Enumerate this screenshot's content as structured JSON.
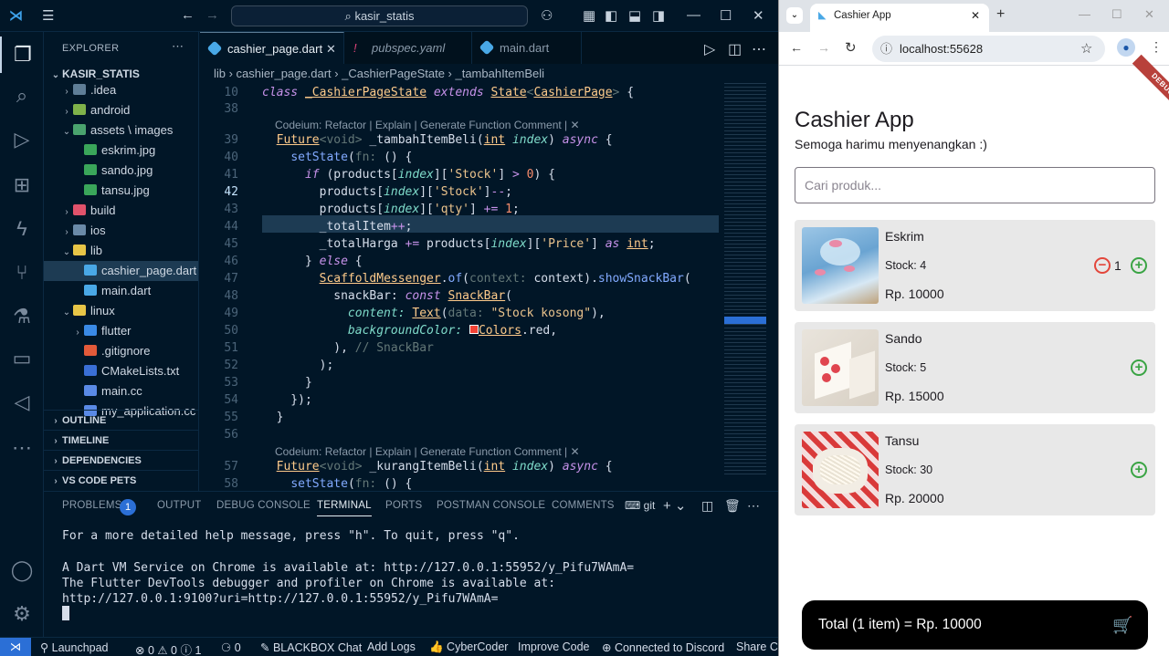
{
  "vscode": {
    "search_text": "kasir_statis",
    "sidebar": {
      "title": "EXPLORER",
      "tree": [
        {
          "label": ".idea",
          "chev": "›"
        },
        {
          "label": "android",
          "chev": "›"
        },
        {
          "label": "assets \\ images",
          "chev": "⌄"
        },
        {
          "label": "eskrim.jpg",
          "chev": ""
        },
        {
          "label": "sando.jpg",
          "chev": ""
        },
        {
          "label": "tansu.jpg",
          "chev": ""
        },
        {
          "label": "build",
          "chev": "›"
        },
        {
          "label": "ios",
          "chev": "›"
        },
        {
          "label": "lib",
          "chev": "⌄"
        },
        {
          "label": "cashier_page.dart",
          "chev": ""
        },
        {
          "label": "main.dart",
          "chev": ""
        },
        {
          "label": "linux",
          "chev": "⌄"
        },
        {
          "label": "flutter",
          "chev": "›"
        },
        {
          "label": ".gitignore",
          "chev": ""
        },
        {
          "label": "CMakeLists.txt",
          "chev": ""
        },
        {
          "label": "main.cc",
          "chev": ""
        },
        {
          "label": "my_application.cc",
          "chev": ""
        }
      ],
      "root": "KASIR_STATIS",
      "sections": [
        "OUTLINE",
        "TIMELINE",
        "DEPENDENCIES",
        "VS CODE PETS"
      ]
    },
    "tabs": [
      {
        "label": "cashier_page.dart"
      },
      {
        "label": "pubspec.yaml"
      },
      {
        "label": "main.dart"
      }
    ],
    "breadcrumb": "lib › cashier_page.dart › _CashierPageState › _tambahItemBeli",
    "codelens": "Codeium: Refactor | Explain | Generate Function Comment | ✕",
    "line_numbers": [
      "10",
      "38",
      "39",
      "40",
      "41",
      "42",
      "43",
      "44",
      "45",
      "46",
      "47",
      "48",
      "49",
      "50",
      "51",
      "52",
      "53",
      "54",
      "55",
      "56",
      "57",
      "58"
    ],
    "panel": {
      "tabs": [
        "PROBLEMS",
        "OUTPUT",
        "DEBUG CONSOLE",
        "TERMINAL",
        "PORTS",
        "POSTMAN CONSOLE",
        "COMMENTS"
      ],
      "problems_count": "1",
      "terminal_name": "git",
      "terminal_lines": [
        "For a more detailed help message, press \"h\". To quit, press \"q\".",
        "",
        "A Dart VM Service on Chrome is available at: http://127.0.0.1:55952/y_Pifu7WAmA=",
        "The Flutter DevTools debugger and profiler on Chrome is available at:",
        "http://127.0.0.1:9100?uri=http://127.0.0.1:55952/y_Pifu7WAmA="
      ]
    },
    "status": {
      "launchpad": "Launchpad",
      "problems": "⊗ 0 ⚠ 0 ⓘ 1",
      "ports": "0",
      "blackbox": "BLACKBOX Chat",
      "addlogs": "Add Logs",
      "cybercoder": "CyberCoder",
      "improve": "Improve Code",
      "discord": "Connected to Discord",
      "share": "Share Co"
    }
  },
  "browser": {
    "tab_title": "Cashier App",
    "url": "localhost:55628",
    "debug_banner": "DEBUG",
    "app": {
      "title": "Cashier App",
      "subtitle": "Semoga harimu menyenangkan :)",
      "search_placeholder": "Cari produk...",
      "products": [
        {
          "name": "Eskrim",
          "stock": "Stock: 4",
          "price": "Rp. 10000",
          "qty": "1"
        },
        {
          "name": "Sando",
          "stock": "Stock: 5",
          "price": "Rp. 15000"
        },
        {
          "name": "Tansu",
          "stock": "Stock: 30",
          "price": "Rp. 20000"
        }
      ],
      "total": "Total (1 item) = Rp. 10000"
    }
  },
  "colors": {
    "accent": "#82aaff",
    "keyword": "#c792ea",
    "string": "#ecc48d",
    "add": "#3aa444",
    "remove": "#e3463b"
  }
}
